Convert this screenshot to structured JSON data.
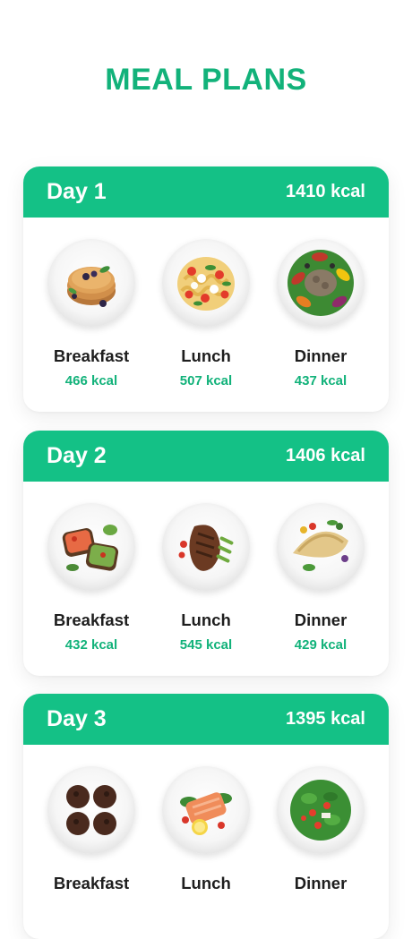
{
  "title": "MEAL PLANS",
  "days": [
    {
      "label": "Day 1",
      "kcal": "1410 kcal",
      "meals": [
        {
          "name": "Breakfast",
          "kcal": "466 kcal",
          "icon": "pancakes-plate-icon"
        },
        {
          "name": "Lunch",
          "kcal": "507 kcal",
          "icon": "pasta-salad-plate-icon"
        },
        {
          "name": "Dinner",
          "kcal": "437 kcal",
          "icon": "tuna-salad-plate-icon"
        }
      ]
    },
    {
      "label": "Day 2",
      "kcal": "1406 kcal",
      "meals": [
        {
          "name": "Breakfast",
          "kcal": "432 kcal",
          "icon": "avocado-toast-plate-icon"
        },
        {
          "name": "Lunch",
          "kcal": "545 kcal",
          "icon": "steak-plate-icon"
        },
        {
          "name": "Dinner",
          "kcal": "429 kcal",
          "icon": "crepe-plate-icon"
        }
      ]
    },
    {
      "label": "Day 3",
      "kcal": "1395 kcal",
      "meals": [
        {
          "name": "Breakfast",
          "kcal": "",
          "icon": "muffins-plate-icon"
        },
        {
          "name": "Lunch",
          "kcal": "",
          "icon": "salmon-plate-icon"
        },
        {
          "name": "Dinner",
          "kcal": "",
          "icon": "spinach-salad-plate-icon"
        }
      ]
    }
  ],
  "colors": {
    "accent": "#14c186",
    "title": "#12b27a",
    "text": "#1e1e1e"
  }
}
